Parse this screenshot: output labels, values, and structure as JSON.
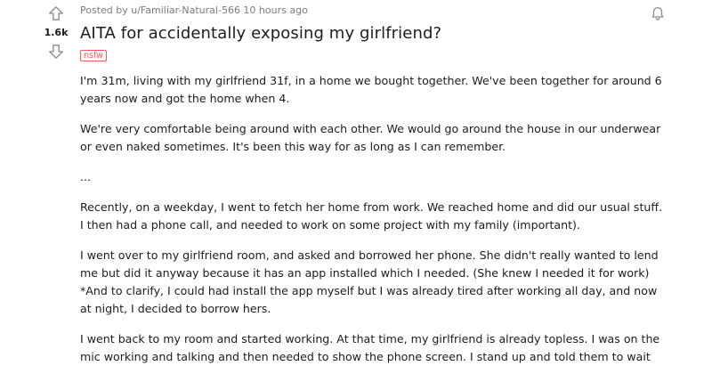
{
  "vote": {
    "count": "1.6k"
  },
  "post": {
    "meta": "Posted by u/Familiar-Natural-566 10 hours ago",
    "title": "AITA for accidentally exposing my girlfriend?",
    "flair": "nsfw",
    "paragraphs": [
      "I'm 31m, living with my girlfriend 31f, in a home we bought together. We've been together for around 6 years now and got the home when 4.",
      "We're very comfortable being around with each other. We would go around the house in our underwear or even naked sometimes. It's been this way for as long as I can remember.",
      "...",
      "Recently, on a weekday, I went to fetch her home from work. We reached home and did our usual stuff. I then had a phone call, and needed to work on some project with my family (important).",
      "I went over to my girlfriend room, and asked and borrowed her phone. She didn't really wanted to lend me but did it anyway because it has an app installed which I needed. (She knew I needed it for work) *And to clarify, I could had install the app myself but I was already tired after working all day, and now at night, I decided to borrow hers.",
      "I went back to my room and started working. At that time, my girlfriend is already topless. I was on the mic working and talking and then needed to show the phone screen. I stand up and told them to wait"
    ]
  },
  "icons": {
    "upvote": "upvote-arrow-icon",
    "downvote": "downvote-arrow-icon",
    "follow": "bell-icon"
  },
  "colors": {
    "flair": "#ff585b",
    "meta": "#787c7e",
    "text": "#1c1c1c"
  }
}
